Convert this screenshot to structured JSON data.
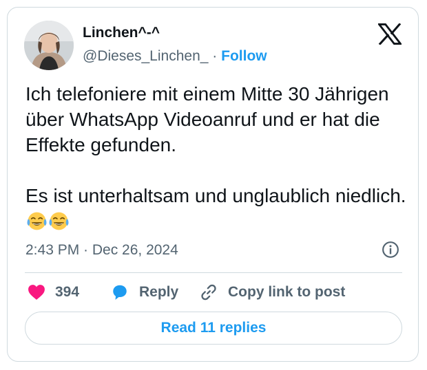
{
  "author": {
    "display_name": "Linchen^-^",
    "handle": "@Dieses_Linchen_",
    "separator": "·",
    "follow_label": "Follow"
  },
  "tweet": {
    "text": "Ich telefoniere mit einem Mitte 30 Jährigen über WhatsApp Videoanruf und er hat die Effekte gefunden.\n\nEs ist unterhaltsam und unglaublich niedlich.",
    "emojis": [
      "face-with-tears-of-joy",
      "face-with-tears-of-joy"
    ],
    "timestamp": "2:43 PM · Dec 26, 2024"
  },
  "actions": {
    "like_count": "394",
    "reply_label": "Reply",
    "copy_label": "Copy link to post"
  },
  "read_replies_label": "Read 11 replies",
  "icons": {
    "logo": "x-logo-icon",
    "info": "info-icon",
    "like": "heart-icon",
    "reply": "speech-bubble-icon",
    "copy": "link-icon"
  },
  "colors": {
    "accent": "#1d9bf0",
    "like": "#f91880",
    "muted": "#536471",
    "text": "#0f1419",
    "border": "#cfd9de"
  }
}
